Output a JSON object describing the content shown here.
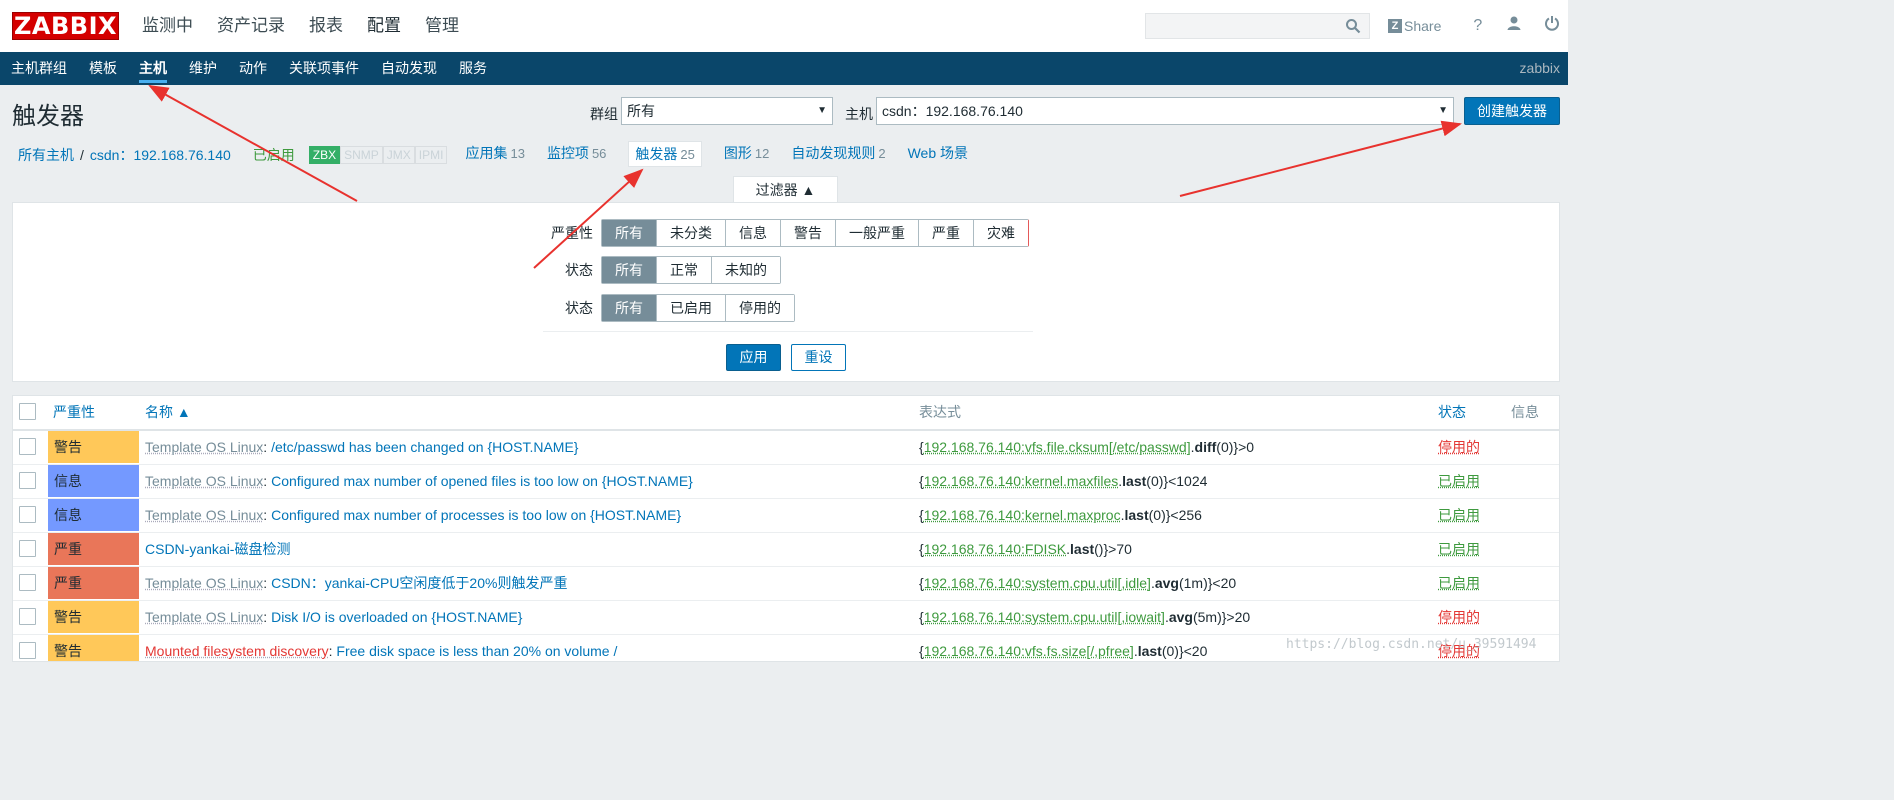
{
  "logo": "ZABBIX",
  "topnav": [
    "监测中",
    "资产记录",
    "报表",
    "配置",
    "管理"
  ],
  "topbar": {
    "search_value": "",
    "share": "Share",
    "help_glyph": "?",
    "search_icon": "search-icon",
    "user_icon": "user-icon",
    "power_icon": "power-icon"
  },
  "subnav": {
    "items": [
      "主机群组",
      "模板",
      "主机",
      "维护",
      "动作",
      "关联项事件",
      "自动发现",
      "服务"
    ],
    "brand": "zabbix"
  },
  "page": {
    "title": "触发器",
    "group_label": "群组",
    "group_value": "所有",
    "host_label": "主机",
    "host_value": "csdn：192.168.76.140",
    "create_button": "创建触发器"
  },
  "breadcrumb": {
    "all_hosts": "所有主机",
    "sep": "/",
    "host": "csdn：192.168.76.140",
    "status": "已启用",
    "tags": [
      "ZBX",
      "SNMP",
      "JMX",
      "IPMI"
    ],
    "tabs": [
      {
        "label": "应用集",
        "count": "13"
      },
      {
        "label": "监控项",
        "count": "56"
      },
      {
        "label": "触发器",
        "count": "25"
      },
      {
        "label": "图形",
        "count": "12"
      },
      {
        "label": "自动发现规则",
        "count": "2"
      },
      {
        "label": "Web 场景",
        "count": ""
      }
    ]
  },
  "filter": {
    "tab_label": "过滤器 ▲",
    "severity_label": "严重性",
    "severity_options": [
      "所有",
      "未分类",
      "信息",
      "警告",
      "一般严重",
      "严重",
      "灾难"
    ],
    "state_label": "状态",
    "state_options": [
      "所有",
      "正常",
      "未知的"
    ],
    "status_label": "状态",
    "status_options": [
      "所有",
      "已启用",
      "停用的"
    ],
    "apply": "应用",
    "reset": "重设"
  },
  "table": {
    "headers": {
      "severity": "严重性",
      "name": "名称 ▲",
      "expression": "表达式",
      "status": "状态",
      "info": "信息"
    },
    "rows": [
      {
        "severity": "警告",
        "sev_color": "#ffc859",
        "tmpl": "Template OS Linux",
        "tmpl_red": false,
        "name": "/etc/passwd has been changed on {HOST.NAME}",
        "e_open": "{",
        "e_item": "192.168.76.140:vfs.file.cksum[/etc/passwd]",
        "e_dot": ".",
        "e_fn": "diff",
        "e_args": "(0)}>0",
        "status": "停用的",
        "enabled": false
      },
      {
        "severity": "信息",
        "sev_color": "#7499ff",
        "tmpl": "Template OS Linux",
        "tmpl_red": false,
        "name": "Configured max number of opened files is too low on {HOST.NAME}",
        "e_open": "{",
        "e_item": "192.168.76.140:kernel.maxfiles",
        "e_dot": ".",
        "e_fn": "last",
        "e_args": "(0)}<1024",
        "status": "已启用",
        "enabled": true
      },
      {
        "severity": "信息",
        "sev_color": "#7499ff",
        "tmpl": "Template OS Linux",
        "tmpl_red": false,
        "name": "Configured max number of processes is too low on {HOST.NAME}",
        "e_open": "{",
        "e_item": "192.168.76.140:kernel.maxproc",
        "e_dot": ".",
        "e_fn": "last",
        "e_args": "(0)}<256",
        "status": "已启用",
        "enabled": true
      },
      {
        "severity": "严重",
        "sev_color": "#e97659",
        "tmpl": "",
        "tmpl_red": false,
        "name": "CSDN-yankai-磁盘检测",
        "e_open": "{",
        "e_item": "192.168.76.140:FDISK",
        "e_dot": ".",
        "e_fn": "last",
        "e_args": "()}>70",
        "status": "已启用",
        "enabled": true
      },
      {
        "severity": "严重",
        "sev_color": "#e97659",
        "tmpl": "Template OS Linux",
        "tmpl_red": false,
        "name": "CSDN：yankai-CPU空闲度低于20%则触发严重",
        "e_open": "{",
        "e_item": "192.168.76.140:system.cpu.util[,idle]",
        "e_dot": ".",
        "e_fn": "avg",
        "e_args": "(1m)}<20",
        "status": "已启用",
        "enabled": true
      },
      {
        "severity": "警告",
        "sev_color": "#ffc859",
        "tmpl": "Template OS Linux",
        "tmpl_red": false,
        "name": "Disk I/O is overloaded on {HOST.NAME}",
        "e_open": "{",
        "e_item": "192.168.76.140:system.cpu.util[,iowait]",
        "e_dot": ".",
        "e_fn": "avg",
        "e_args": "(5m)}>20",
        "status": "停用的",
        "enabled": false
      },
      {
        "severity": "警告",
        "sev_color": "#ffc859",
        "tmpl": "Mounted filesystem discovery",
        "tmpl_red": true,
        "name": "Free disk space is less than 20% on volume /",
        "e_open": "{",
        "e_item": "192.168.76.140:vfs.fs.size[/,pfree]",
        "e_dot": ".",
        "e_fn": "last",
        "e_args": "(0)}<20",
        "status": "停用的",
        "enabled": false
      }
    ]
  },
  "watermark": "https://blog.csdn.net/u_39591494",
  "colors": {
    "accent": "#0275b8",
    "nav_bg": "#0a466a",
    "logo_red": "#d40000",
    "arrow": "#e8322e"
  }
}
